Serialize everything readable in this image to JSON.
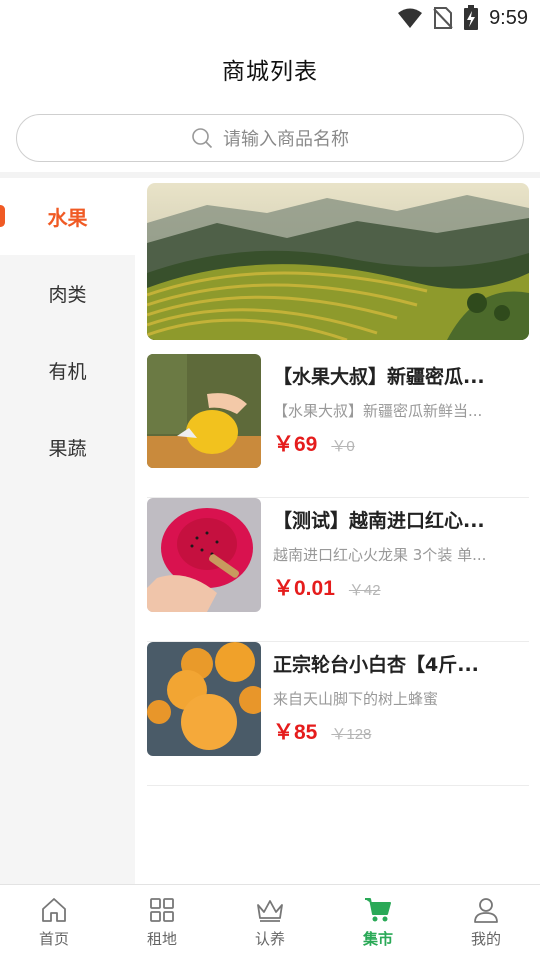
{
  "status_bar": {
    "time": "9:59",
    "icons": [
      "wifi-icon",
      "no-sim-icon",
      "battery-charging-icon"
    ]
  },
  "header": {
    "title": "商城列表"
  },
  "search": {
    "placeholder": "请输入商品名称",
    "icon": "search-icon"
  },
  "sidebar": {
    "items": [
      {
        "label": "水果",
        "active": true
      },
      {
        "label": "肉类",
        "active": false
      },
      {
        "label": "有机",
        "active": false
      },
      {
        "label": "果蔬",
        "active": false
      }
    ]
  },
  "banner": {
    "image": "terraced-rice-fields-banner"
  },
  "products": [
    {
      "title": "【水果大叔】新疆密瓜...",
      "desc": "【水果大叔】新疆密瓜新鲜当...",
      "price": "￥69",
      "old_price": "￥0",
      "image": "melon-thumbnail"
    },
    {
      "title": "【测试】越南进口红心...",
      "desc": "越南进口红心火龙果 3个装 单...",
      "price": "￥0.01",
      "old_price": "￥42",
      "image": "dragon-fruit-thumbnail"
    },
    {
      "title": "正宗轮台小白杏【4斤...",
      "desc": "来自天山脚下的树上蜂蜜",
      "price": "￥85",
      "old_price": "￥128",
      "image": "apricot-thumbnail"
    }
  ],
  "tabbar": {
    "items": [
      {
        "label": "首页",
        "icon": "home-icon",
        "active": false
      },
      {
        "label": "租地",
        "icon": "grid-icon",
        "active": false
      },
      {
        "label": "认养",
        "icon": "crown-icon",
        "active": false
      },
      {
        "label": "集市",
        "icon": "cart-icon",
        "active": true
      },
      {
        "label": "我的",
        "icon": "user-icon",
        "active": false
      }
    ]
  },
  "colors": {
    "accent": "#f05a24",
    "price": "#e51c1c",
    "tab_active": "#2aa957"
  }
}
